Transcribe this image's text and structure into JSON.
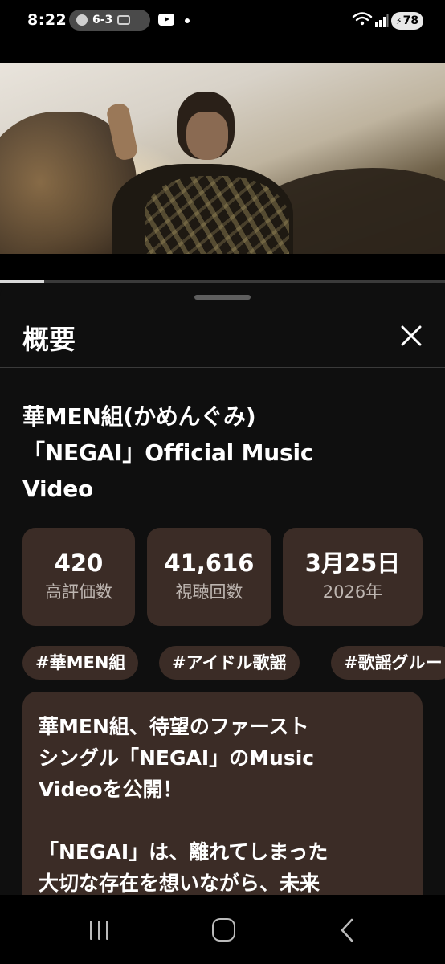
{
  "status_bar": {
    "time": "8:22",
    "score": "6-3",
    "battery": "78",
    "icons": [
      "team-logo-icon",
      "youtube-icon",
      "wifi-icon",
      "signal-icon",
      "battery-saver-icon"
    ]
  },
  "video": {
    "progress": 0.1
  },
  "description_sheet": {
    "title": "概要",
    "video_title_lines": [
      "華MEN組(かめんぐみ)",
      "「NEGAI」Official Music",
      "Video"
    ],
    "stats": [
      {
        "value": "420",
        "label": "高評価数"
      },
      {
        "value": "41,616",
        "label": "視聴回数"
      },
      {
        "value": "3月25日",
        "label": "2026年"
      }
    ],
    "hashtags": [
      "#華MEN組",
      "#アイドル歌謡",
      "#歌謡グルー"
    ],
    "description_lines": [
      "華MEN組、待望のファースト",
      "シングル「NEGAI」のMusic",
      "Videoを公開！",
      "",
      "「NEGAI」は、離れてしまった",
      "大切な存在を想いながら、未来"
    ]
  },
  "nav_bar": {
    "icons": [
      "recents-icon",
      "home-icon",
      "back-icon"
    ]
  },
  "colors": {
    "background": "#0f0f0f",
    "card": "#3b2c26",
    "text_primary": "#ffffff",
    "text_secondary": "#bdb5b0"
  }
}
